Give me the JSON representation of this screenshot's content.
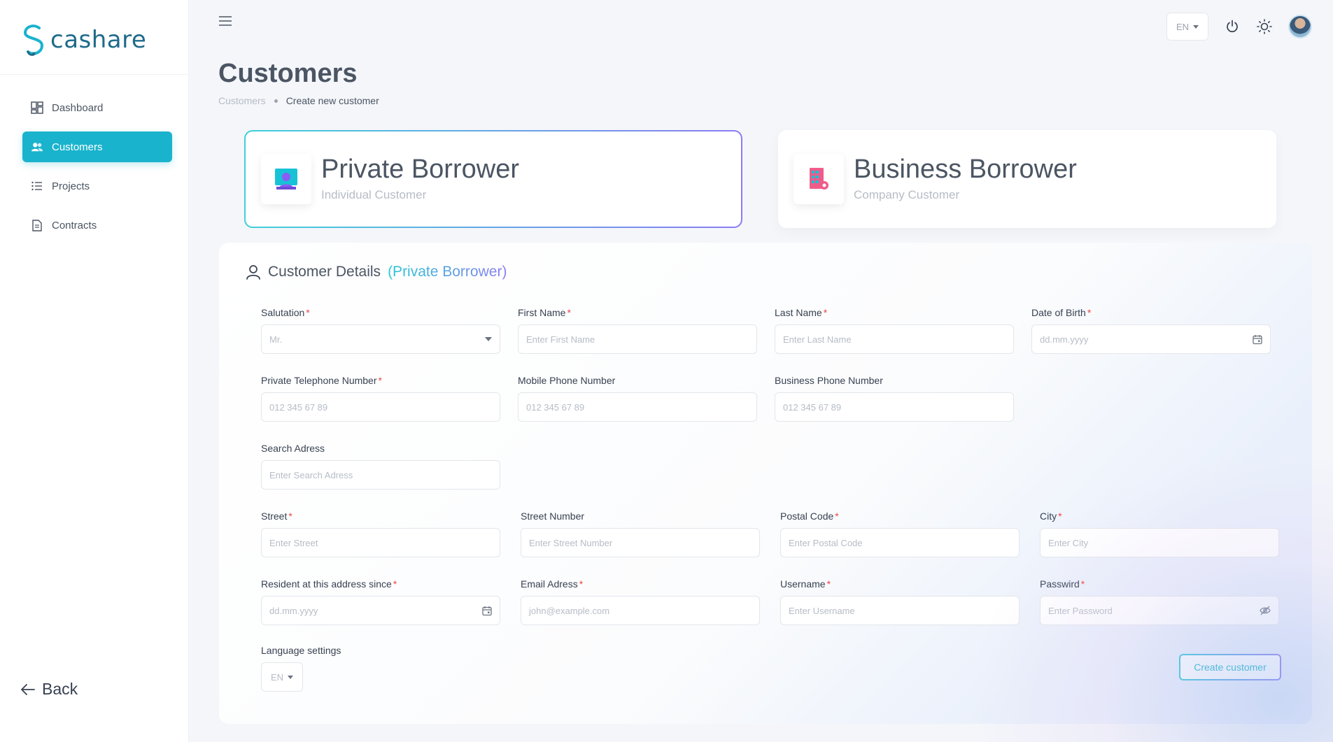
{
  "app": {
    "name": "cashare"
  },
  "sidebar": {
    "items": [
      {
        "label": "Dashboard",
        "icon": "dashboard-icon",
        "active": false
      },
      {
        "label": "Customers",
        "icon": "users-icon",
        "active": true
      },
      {
        "label": "Projects",
        "icon": "list-icon",
        "active": false
      },
      {
        "label": "Contracts",
        "icon": "document-icon",
        "active": false
      }
    ],
    "back_label": "Back"
  },
  "topbar": {
    "language": "EN"
  },
  "page": {
    "title": "Customers",
    "breadcrumb": [
      "Customers",
      "Create new customer"
    ]
  },
  "customer_types": [
    {
      "title": "Private Borrower",
      "subtitle": "Individual Customer",
      "selected": true
    },
    {
      "title": "Business Borrower",
      "subtitle": "Company Customer",
      "selected": false
    }
  ],
  "form": {
    "title": "Customer Details",
    "title_accent": "(Private Borrower)",
    "fields": {
      "salutation": {
        "label": "Salutation",
        "required": "*",
        "value": "Mr."
      },
      "first_name": {
        "label": "First Name",
        "required": "*",
        "placeholder": "Enter First Name"
      },
      "last_name": {
        "label": "Last Name",
        "required": "*",
        "placeholder": "Enter Last Name"
      },
      "dob": {
        "label": "Date of Birth",
        "required": "*",
        "placeholder": "dd.mm.yyyy"
      },
      "private_phone": {
        "label": "Private Telephone Number",
        "required": "*",
        "placeholder": "012 345 67 89"
      },
      "mobile_phone": {
        "label": "Mobile Phone Number",
        "placeholder": "012 345 67 89"
      },
      "business_phone": {
        "label": "Business Phone Number",
        "placeholder": "012 345 67 89"
      },
      "search_address": {
        "label": "Search Adress",
        "placeholder": "Enter Search Adress"
      },
      "street": {
        "label": "Street",
        "required": "*",
        "placeholder": "Enter Street"
      },
      "street_number": {
        "label": "Street Number",
        "placeholder": "Enter Street Number"
      },
      "postal_code": {
        "label": "Postal Code",
        "required": "*",
        "placeholder": "Enter Postal Code"
      },
      "city": {
        "label": "City",
        "required": "*",
        "placeholder": "Enter City"
      },
      "resident_since": {
        "label": "Resident at this address since",
        "required": "*",
        "placeholder": "dd.mm.yyyy"
      },
      "email": {
        "label": "Email Adress",
        "required": "*",
        "placeholder": "john@example.com"
      },
      "username": {
        "label": "Username",
        "required": "*",
        "placeholder": "Enter Username"
      },
      "password": {
        "label": "Passwird",
        "required": "*",
        "placeholder": "Enter Password"
      },
      "language": {
        "label": "Language settings",
        "value": "EN"
      }
    },
    "submit_label": "Create customer"
  },
  "colors": {
    "accent": "#1ab3cd",
    "accent_gradient_end": "#8b7cf2",
    "required": "#ef4444"
  }
}
